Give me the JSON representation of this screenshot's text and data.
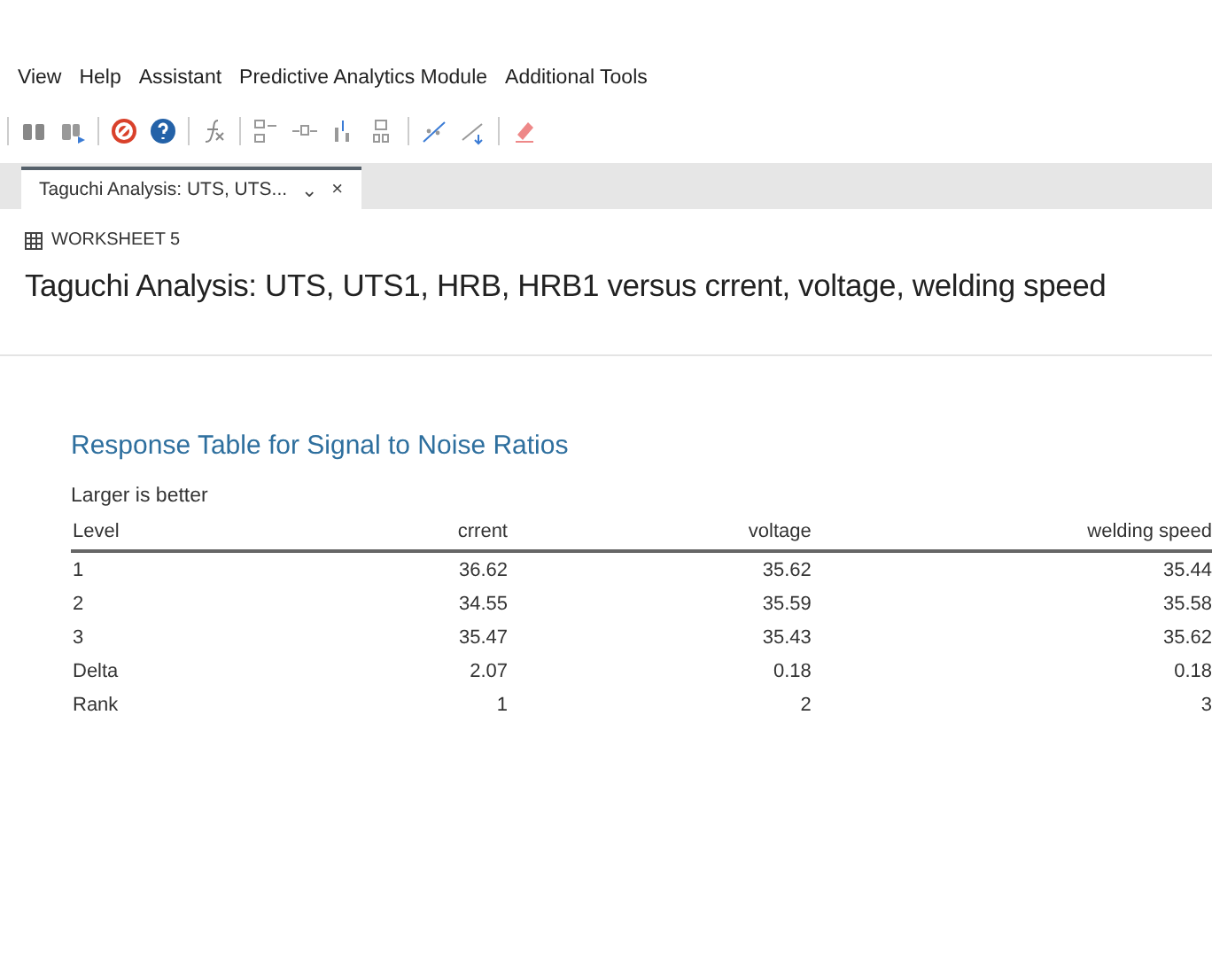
{
  "menu": [
    "View",
    "Help",
    "Assistant",
    "Predictive Analytics Module",
    "Additional Tools"
  ],
  "tab": {
    "label": "Taguchi Analysis: UTS, UTS...",
    "caret": "⌄",
    "close": "×",
    "selected": true
  },
  "worksheet": "WORKSHEET 5",
  "title": "Taguchi Analysis: UTS, UTS1, HRB, HRB1 versus crrent, voltage, welding speed",
  "section": {
    "heading": "Response Table for Signal to Noise Ratios",
    "note": "Larger is better",
    "table": {
      "columns": [
        "Level",
        "crrent",
        "voltage",
        "welding speed"
      ],
      "rows": [
        [
          "1",
          "36.62",
          "35.62",
          "35.44"
        ],
        [
          "2",
          "34.55",
          "35.59",
          "35.58"
        ],
        [
          "3",
          "35.47",
          "35.43",
          "35.62"
        ],
        [
          "Delta",
          "2.07",
          "0.18",
          "0.18"
        ],
        [
          "Rank",
          "1",
          "2",
          "3"
        ]
      ]
    }
  }
}
